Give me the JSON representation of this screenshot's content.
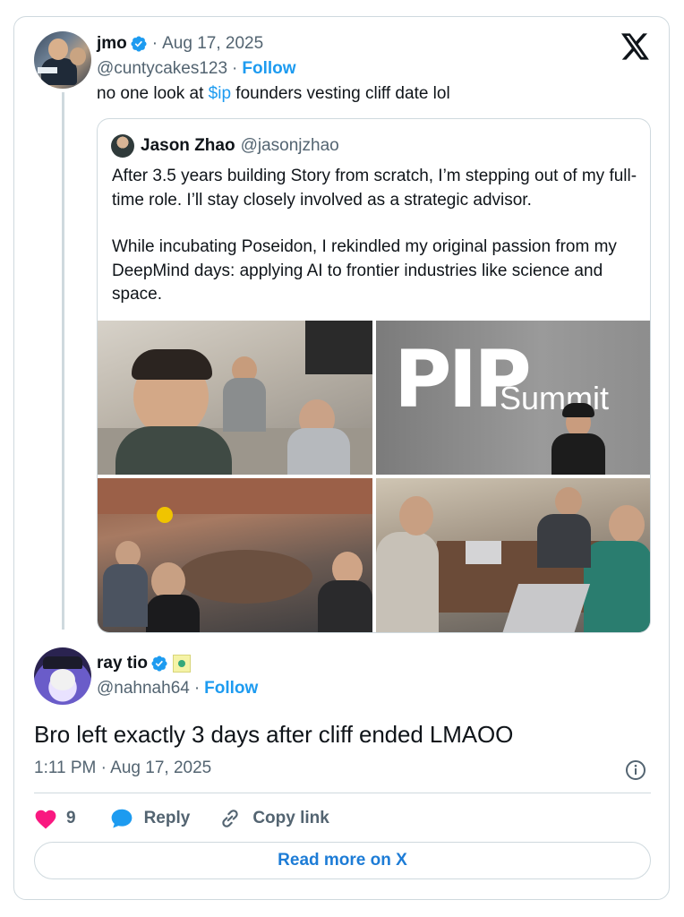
{
  "tweet": {
    "author_name": "jmo",
    "date": "Aug 17, 2025",
    "handle": "@cuntycakes123",
    "follow_label": "Follow",
    "text_before": "no one look at ",
    "cashtag": "$ip",
    "text_after": " founders vesting cliff date lol"
  },
  "quote": {
    "author_name": "Jason Zhao",
    "handle": "@jasonjzhao",
    "paragraph_1": "After 3.5 years building Story from scratch, I’m stepping out of my full-time role. I’ll stay closely involved as a strategic advisor.",
    "paragraph_2": "While incubating Poseidon, I rekindled my original passion from my DeepMind days: applying AI to frontier industries like science and space.",
    "photo_2_text": "Summit"
  },
  "reply": {
    "author_name": "ray tio",
    "handle": "@nahnah64",
    "follow_label": "Follow",
    "text": "Bro left exactly 3 days after cliff ended LMAOO",
    "timestamp": "1:11 PM · Aug 17, 2025"
  },
  "actions": {
    "like_count": "9",
    "reply_label": "Reply",
    "copy_link_label": "Copy link"
  },
  "read_more_label": "Read more on X",
  "colors": {
    "accent": "#1d9bf0",
    "like": "#f91880",
    "muted": "#536471",
    "border": "#cfd9de"
  },
  "icons": [
    "verified-badge-icon",
    "x-logo-icon",
    "info-icon",
    "heart-icon",
    "reply-bubble-icon",
    "link-icon"
  ]
}
